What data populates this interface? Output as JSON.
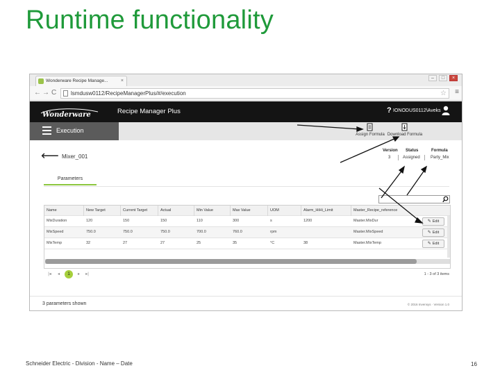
{
  "slide": {
    "title": "Runtime functionality",
    "footer": "Schneider Electric - Division - Name – Date",
    "page_number": "16"
  },
  "browser": {
    "tab_title": "Wonderware Recipe Manage...",
    "tab_close": "×",
    "url": "lsmdusw0112/RecipeManagerPlus/#/execution",
    "back": "←",
    "forward": "→",
    "reload": "C",
    "star": "☆",
    "menu": "≡",
    "minimize": "–",
    "maximize": "□",
    "close": "×"
  },
  "app": {
    "logo_text": "Wonderware",
    "title": "Recipe Manager Plus",
    "help": "?",
    "username": "IONODUS0112\\Aveks"
  },
  "toolbar": {
    "section_label": "Execution",
    "assign_formula": "Assign Formula",
    "download_formula": "Download Formula"
  },
  "recipe": {
    "back": "⟵",
    "name": "Mixer_001",
    "version_label": "Version",
    "version_value": "3",
    "status_label": "Status",
    "status_value": "Assigned",
    "formula_label": "Formula",
    "formula_value": "Party_Mix"
  },
  "tabs": {
    "parameters": "Parameters"
  },
  "grid": {
    "columns": [
      "Name",
      "New Target",
      "Current Target",
      "Actual",
      "Min Value",
      "Max Value",
      "UOM",
      "Alarm_HiHi_Limit",
      "Master_Recipe_reference"
    ],
    "rows": [
      [
        "MixDuration",
        "120",
        "150",
        "150",
        "110",
        "300",
        "s",
        "1200",
        "Master.MixDur"
      ],
      [
        "MixSpeed",
        "750.0",
        "750.0",
        "750.0",
        "700.0",
        "760.0",
        "rpm",
        "",
        "Master.MixSpeed"
      ],
      [
        "MixTemp",
        "32",
        "27",
        "27",
        "25",
        "35",
        "°C",
        "38",
        "Master.MixTemp"
      ]
    ],
    "edit_label": "Edit",
    "edit_icon": "✎"
  },
  "pager": {
    "first": "|◂",
    "prev": "◂",
    "current_page": "1",
    "next": "▸",
    "last": "▸|",
    "info": "1 - 3 of 3 items"
  },
  "status": {
    "text": "3 parameters shown",
    "copyright": "© 2016 Invensys · Version 1.0"
  },
  "colors": {
    "title_green": "#1f9a3a",
    "accent_green": "#8cc63e",
    "header_black": "#141414",
    "execution_gray": "#5b5b5b"
  }
}
